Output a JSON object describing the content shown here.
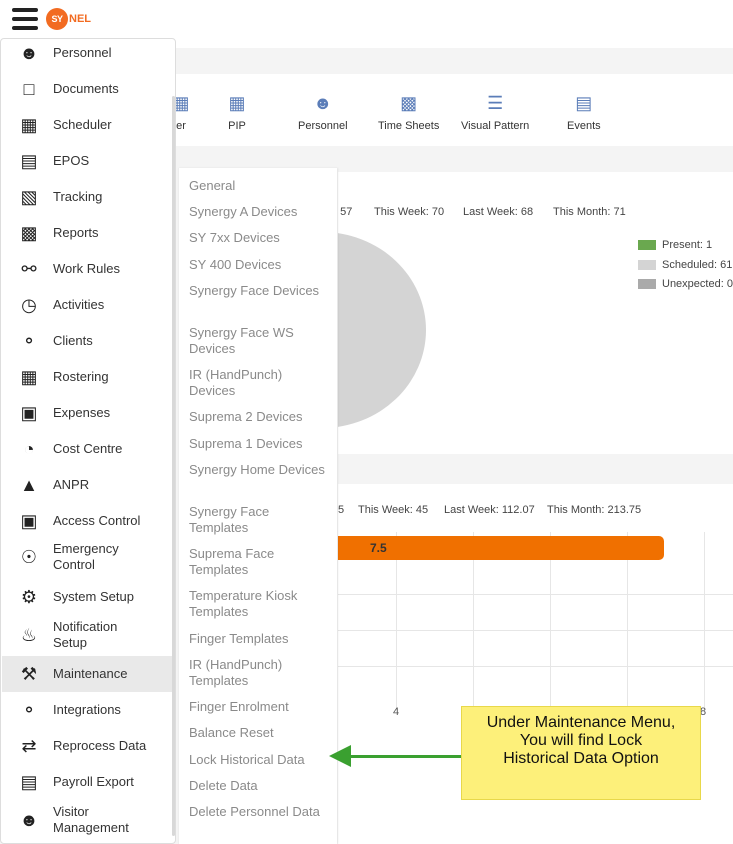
{
  "header": {
    "logo_mark": "SY",
    "logo_text": "NEL"
  },
  "quick_actions": [
    {
      "label": "er",
      "icon": "scheduler-icon"
    },
    {
      "label": "PIP",
      "icon": "grid-icon"
    },
    {
      "label": "Personnel",
      "icon": "personnel-icon"
    },
    {
      "label": "Time Sheets",
      "icon": "chart-icon"
    },
    {
      "label": "Visual Pattern",
      "icon": "pattern-icon"
    },
    {
      "label": "Events",
      "icon": "calendar-icon"
    }
  ],
  "attendance_card": {
    "stats": [
      ": 57",
      "This Week: 70",
      "Last Week: 68",
      "This Month: 71"
    ],
    "legend": [
      {
        "label": "Present: 1",
        "color": "#6aa84f"
      },
      {
        "label": "Scheduled: 61",
        "color": "#d4d4d4"
      },
      {
        "label": "Unexpected: 0",
        "color": "#aaaaaa"
      }
    ]
  },
  "hours_card": {
    "stats": [
      "5",
      "This Week: 45",
      "Last Week: 112.07",
      "This Month: 213.75"
    ],
    "bar_value": "7.5",
    "axis_ticks": [
      "4",
      "8"
    ]
  },
  "menu": {
    "items": [
      {
        "label": "Personnel",
        "icon": "person-icon"
      },
      {
        "label": "Documents",
        "icon": "folder-icon"
      },
      {
        "label": "Scheduler",
        "icon": "calendar-icon"
      },
      {
        "label": "EPOS",
        "icon": "pos-terminal-icon"
      },
      {
        "label": "Tracking",
        "icon": "tracking-icon"
      },
      {
        "label": "Reports",
        "icon": "reports-icon"
      },
      {
        "label": "Work Rules",
        "icon": "work-rules-icon"
      },
      {
        "label": "Activities",
        "icon": "timer-icon"
      },
      {
        "label": "Clients",
        "icon": "link-icon"
      },
      {
        "label": "Rostering",
        "icon": "calendar-icon"
      },
      {
        "label": "Expenses",
        "icon": "wallet-icon"
      },
      {
        "label": "Cost Centre",
        "icon": "pie-icon"
      },
      {
        "label": "ANPR",
        "icon": "camera-icon"
      },
      {
        "label": "Access Control",
        "icon": "lock-icon"
      },
      {
        "label": "Emergency\nControl",
        "icon": "emergency-icon"
      },
      {
        "label": "System Setup",
        "icon": "gear-icon"
      },
      {
        "label": "Notification\nSetup",
        "icon": "bell-icon"
      },
      {
        "label": "Maintenance",
        "icon": "tools-icon"
      },
      {
        "label": "Integrations",
        "icon": "link-icon"
      },
      {
        "label": "Reprocess Data",
        "icon": "reprocess-icon"
      },
      {
        "label": "Payroll Export",
        "icon": "csv-icon"
      },
      {
        "label": "Visitor\nManagement",
        "icon": "visitors-icon"
      }
    ],
    "active": "Maintenance"
  },
  "submenu": {
    "items": [
      "General",
      "Synergy A Devices",
      "SY 7xx Devices",
      "SY 400 Devices",
      "Synergy Face Devices",
      "Synergy Face WS Devices",
      "IR (HandPunch) Devices",
      "Suprema 2 Devices",
      "Suprema 1 Devices",
      "Synergy Home Devices",
      "Synergy Face Templates",
      "Suprema Face Templates",
      "Temperature Kiosk Templates",
      "Finger Templates",
      "IR (HandPunch) Templates",
      "Finger Enrolment",
      "Balance Reset",
      "Lock Historical Data",
      "Delete Data",
      "Delete Personnel Data"
    ]
  },
  "callout": {
    "lines": [
      "Under Maintenance Menu,",
      "You will find Lock",
      "Historical Data Option"
    ],
    "color": "#fdf07a",
    "arrow_color": "#3aa030"
  }
}
